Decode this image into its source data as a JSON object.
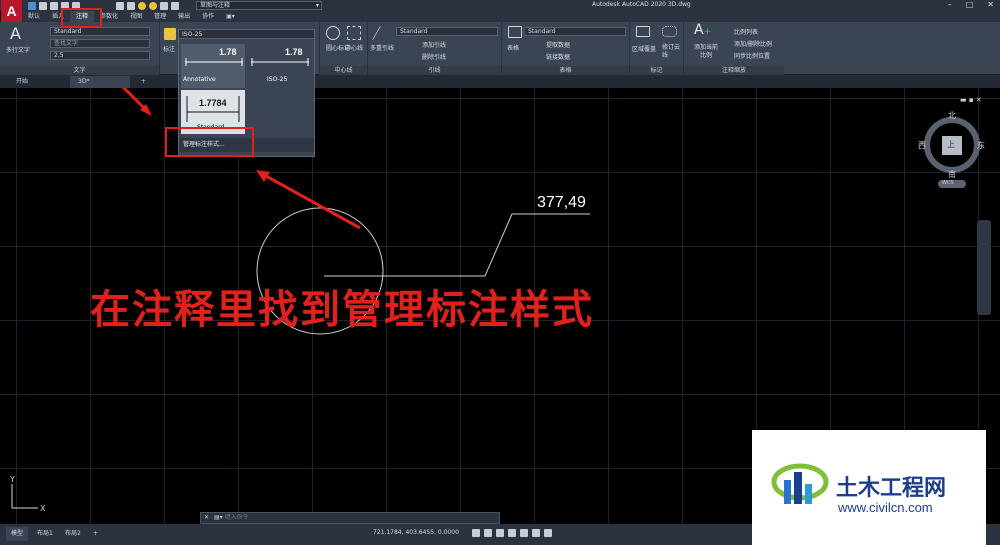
{
  "app_logo": "A",
  "workspace": "草图与注释",
  "window_title": "Autodesk AutoCAD 2020    3D.dwg",
  "window_controls": [
    "–",
    "□",
    "✕"
  ],
  "menu_tabs": [
    "默认",
    "插入",
    "注释",
    "参数化",
    "视图",
    "管理",
    "输出",
    "协作"
  ],
  "ribbon": {
    "text_panel": {
      "mtext_label": "多行文字",
      "text_style": "Standard",
      "find_text": "查找文字",
      "text_height": "2.5",
      "title": "文字"
    },
    "dim_label": "标注",
    "dim_style_value": "ISO-25",
    "centerline_panel": {
      "items": [
        "圆心标记",
        "中心线"
      ],
      "title": "中心线"
    },
    "leader_panel": {
      "multileader_label": "多重引线",
      "style": "Standard",
      "add": "添加引线",
      "remove": "删除引线",
      "title": "引线"
    },
    "table_panel": {
      "table_label": "表格",
      "style": "Standard",
      "extract": "提取数据",
      "link": "链接数据",
      "title": "表格"
    },
    "markup_panel": {
      "items": [
        "区域覆盖",
        "修订云线"
      ],
      "title": "标记"
    },
    "scale_panel": {
      "add_label": "添加当前比例",
      "list": "比例列表",
      "add_remove": "添加/删除比例",
      "sync": "同步比例位置",
      "title": "注释缩放"
    }
  },
  "dim_gallery": {
    "combo_value": "ISO-25",
    "items": [
      {
        "value": "1.78",
        "name": "Annotative"
      },
      {
        "value": "1.78",
        "name": "ISO-25"
      },
      {
        "value": "1.7784",
        "name": "Standard"
      }
    ],
    "manage_label": "管理标注样式..."
  },
  "file_tabs": [
    "开始",
    "3D*"
  ],
  "viewcube": {
    "north": "北",
    "south": "南",
    "east": "东",
    "west": "西",
    "top": "上",
    "wcs": "WCS"
  },
  "drawing": {
    "dimension_text": "377,49"
  },
  "annotation": "在注释里找到管理标注样式",
  "ucs": {
    "y": "Y",
    "x": "X"
  },
  "command_placeholder": "键入命令",
  "layout_tabs": [
    "模型",
    "布局1",
    "布局2"
  ],
  "coordinates": "721.1784, 403.6455, 0.0000",
  "watermark": {
    "name": "土木工程网",
    "url": "www.civilcn.com"
  },
  "colors": {
    "highlight_red": "#e0211d",
    "ribbon_bg": "#3b4453",
    "watermark_blue": "#1c3f8a"
  }
}
